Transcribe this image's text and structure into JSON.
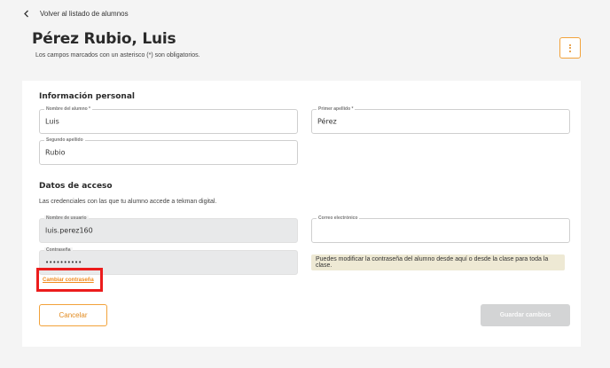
{
  "nav": {
    "back_label": "Volver al listado de alumnos"
  },
  "header": {
    "title": "Pérez Rubio, Luis",
    "subtitle": "Los campos marcados con un asterisco (*) son obligatorios."
  },
  "personal": {
    "section_title": "Información personal",
    "first_name": {
      "label": "Nombre del alumno *",
      "value": "Luis"
    },
    "last_name_1": {
      "label": "Primer apellido *",
      "value": "Pérez"
    },
    "last_name_2": {
      "label": "Segundo apellido",
      "value": "Rubio"
    }
  },
  "access": {
    "section_title": "Datos de acceso",
    "description": "Las credenciales con las que tu alumno accede a tekman digital.",
    "username": {
      "label": "Nombre de usuario",
      "value": "luis.perez160"
    },
    "email": {
      "label": "Correo electrónico",
      "value": ""
    },
    "password": {
      "label": "Contraseña",
      "value": "••••••••••"
    },
    "password_note": "Puedes modificar la contraseña del alumno desde aquí o desde la clase para toda la clase.",
    "change_password_label": "Cambiar contraseña"
  },
  "actions": {
    "cancel_label": "Cancelar",
    "save_label": "Guardar cambios"
  },
  "colors": {
    "accent": "#f2a23a",
    "highlight": "#ec1c1c",
    "note_bg": "#eee9d4",
    "disabled_btn": "#d3d4d5"
  },
  "icons": {
    "back": "chevron-left-icon",
    "menu": "kebab-menu-icon"
  }
}
